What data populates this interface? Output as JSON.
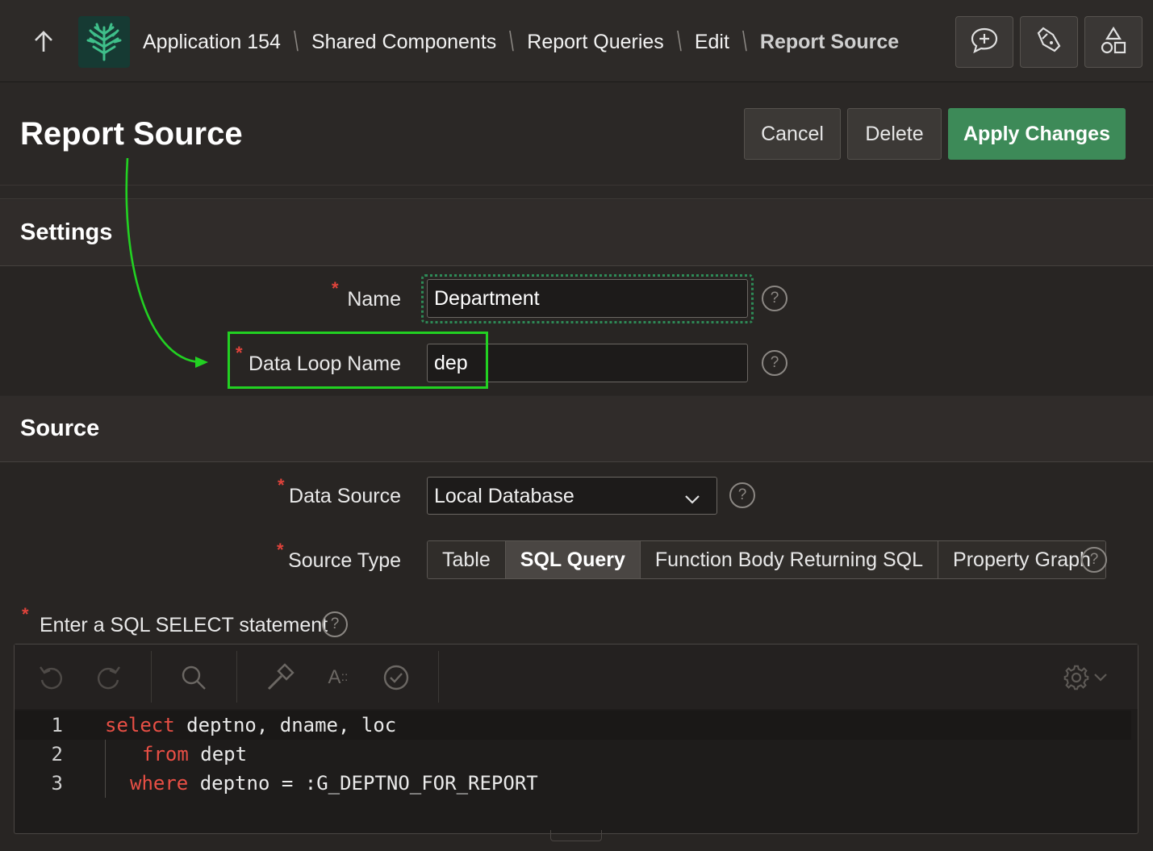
{
  "breadcrumbs": [
    "Application 154",
    "Shared Components",
    "Report Queries",
    "Edit",
    "Report Source"
  ],
  "page_title": "Report Source",
  "buttons": {
    "cancel": "Cancel",
    "delete": "Delete",
    "apply": "Apply Changes"
  },
  "settings": {
    "title": "Settings",
    "name_label": "Name",
    "name_value": "Department",
    "loop_label": "Data Loop Name",
    "loop_value": "dep"
  },
  "source": {
    "title": "Source",
    "data_source_label": "Data Source",
    "data_source_value": "Local Database",
    "source_type_label": "Source Type",
    "source_type_options": [
      "Table",
      "SQL Query",
      "Function Body Returning SQL",
      "Property Graph"
    ],
    "source_type_selected": "SQL Query",
    "sql_label": "Enter a SQL SELECT statement"
  },
  "code": {
    "line_numbers": [
      "1",
      "2",
      "3"
    ],
    "lines": [
      {
        "keyword": "select",
        "rest": " deptno, dname, loc"
      },
      {
        "keyword": "from",
        "rest": " dept"
      },
      {
        "keyword": "where",
        "rest": " deptno = :G_DEPTNO_FOR_REPORT"
      }
    ]
  },
  "help_glyph": "?",
  "required_glyph": "*",
  "colors": {
    "accent_green": "#3d8a58",
    "required_red": "#e0433b",
    "annotation_green": "#22d122",
    "keyword_red": "#e84f45"
  }
}
